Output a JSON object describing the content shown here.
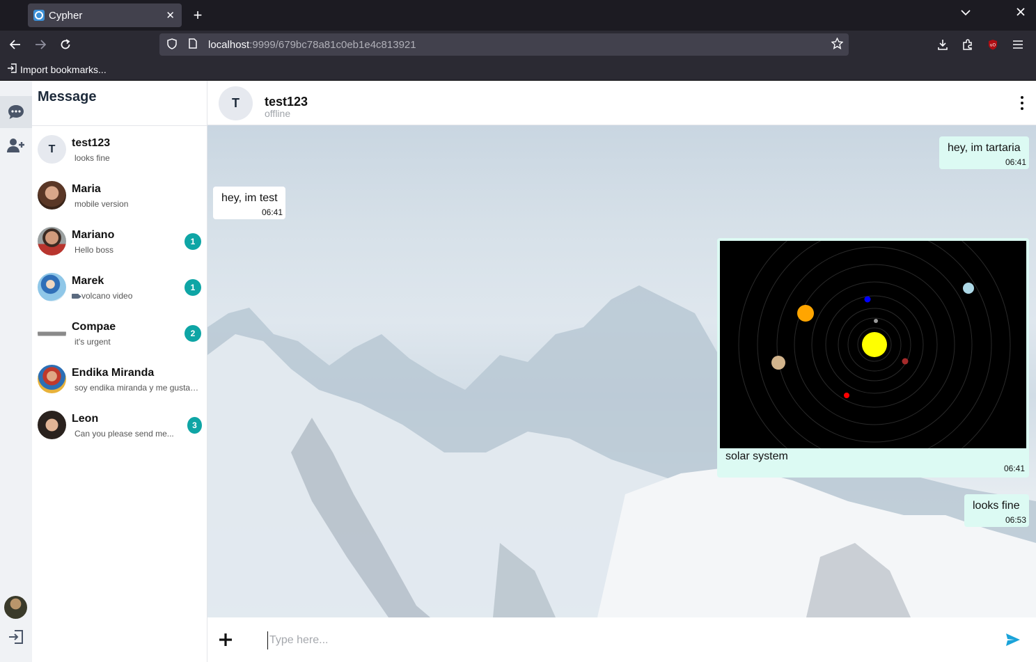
{
  "browser": {
    "tab_title": "Cypher",
    "tab_close": "✕",
    "new_tab": "+",
    "url_host": "localhost",
    "url_rest": ":9999/679bc78a81c0eb1e4c813921",
    "bookmark_label": "Import bookmarks..."
  },
  "sidebar": {
    "title": "Message",
    "contacts": [
      {
        "name": "test123",
        "preview": "looks fine",
        "initial": "T",
        "badge": ""
      },
      {
        "name": "Maria",
        "preview": "mobile version",
        "badge": ""
      },
      {
        "name": "Mariano",
        "preview": "Hello boss",
        "badge": "1"
      },
      {
        "name": "Marek",
        "preview": "volcano video",
        "badge": "1"
      },
      {
        "name": "Compae",
        "preview": "it's urgent",
        "badge": "2"
      },
      {
        "name": "Endika Miranda",
        "preview": "soy endika miranda y me gustaria hablar contigo",
        "badge": ""
      },
      {
        "name": "Leon",
        "preview": "Can you please send me...",
        "badge": "3"
      }
    ]
  },
  "chat": {
    "name": "test123",
    "initial": "T",
    "status": "offline",
    "messages": [
      {
        "text": "hey, im tartaria",
        "time": "06:41"
      },
      {
        "text": "hey, im test",
        "time": "06:41"
      },
      {
        "caption": "solar system",
        "time": "06:41"
      },
      {
        "text": "looks fine",
        "time": "06:53"
      }
    ],
    "input_placeholder": "Type here..."
  },
  "colors": {
    "accent": "#0ea5a5",
    "outgoing_bubble": "#dcfaf3",
    "send_icon": "#1aa3d9"
  }
}
